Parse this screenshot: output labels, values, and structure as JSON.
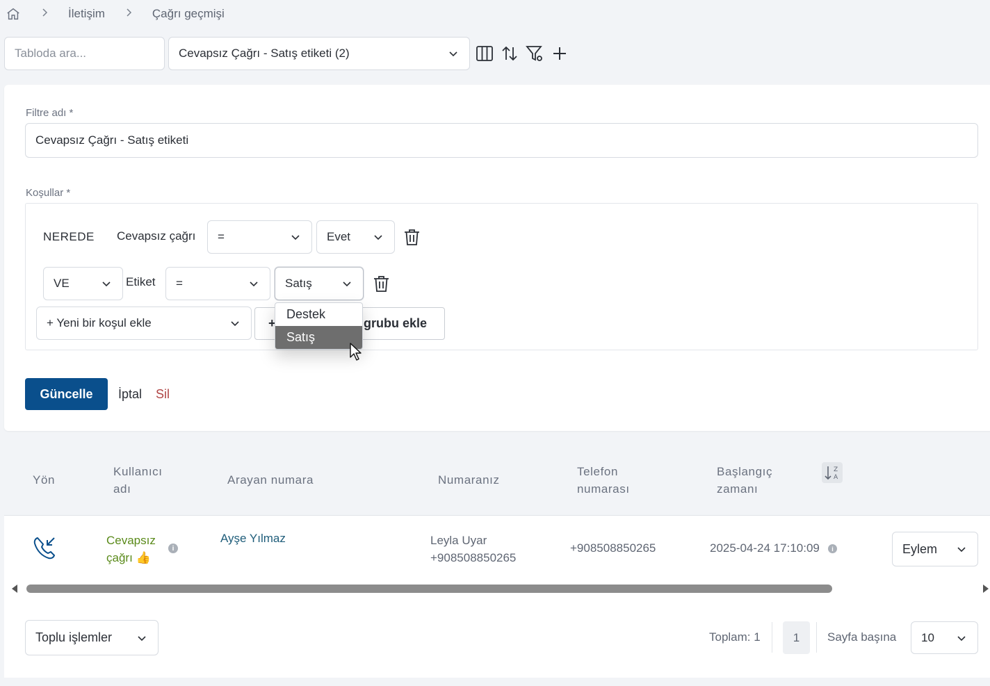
{
  "breadcrumb": {
    "item1": "İletişim",
    "item2": "Çağrı geçmişi"
  },
  "toolbar": {
    "search_placeholder": "Tabloda ara...",
    "filter_selected": "Cevapsız Çağrı - Satış etiketi (2)"
  },
  "filter_form": {
    "name_label": "Filtre adı *",
    "name_value": "Cevapsız Çağrı - Satış etiketi",
    "conditions_label": "Koşullar *",
    "row1": {
      "keyword": "NEREDE",
      "field": "Cevapsız çağrı",
      "operator": "=",
      "value": "Evet"
    },
    "row2": {
      "connector": "VE",
      "field": "Etiket",
      "operator": "=",
      "value": "Satış"
    },
    "add_condition": "+ Yeni bir koşul ekle",
    "add_group_prefix": "+",
    "add_group": "grubu ekle",
    "dropdown_options": [
      "Destek",
      "Satış"
    ],
    "update_button": "Güncelle",
    "cancel_button": "İptal",
    "delete_button": "Sil"
  },
  "table": {
    "headers": {
      "direction": "Yön",
      "username_1": "Kullanıcı",
      "username_2": "adı",
      "caller": "Arayan numara",
      "your_number": "Numaranız",
      "phone_1": "Telefon",
      "phone_2": "numarası",
      "start_1": "Başlangıç",
      "start_2": "zamanı"
    },
    "row": {
      "status_1": "Cevapsız",
      "status_2": "çağrı",
      "caller": "Ayşe Yılmaz",
      "your_name": "Leyla Uyar",
      "your_number": "+908508850265",
      "phone": "+908508850265",
      "start": "2025-04-24 17:10:09",
      "action": "Eylem"
    }
  },
  "footer": {
    "bulk_actions": "Toplu işlemler",
    "total": "Toplam: 1",
    "page": "1",
    "per_page_label": "Sayfa başına",
    "per_page_value": "10"
  },
  "colors": {
    "primary": "#0a4f8c",
    "danger": "#b04545",
    "missed": "#5a8a1a",
    "caller_link": "#1f5d7a"
  }
}
